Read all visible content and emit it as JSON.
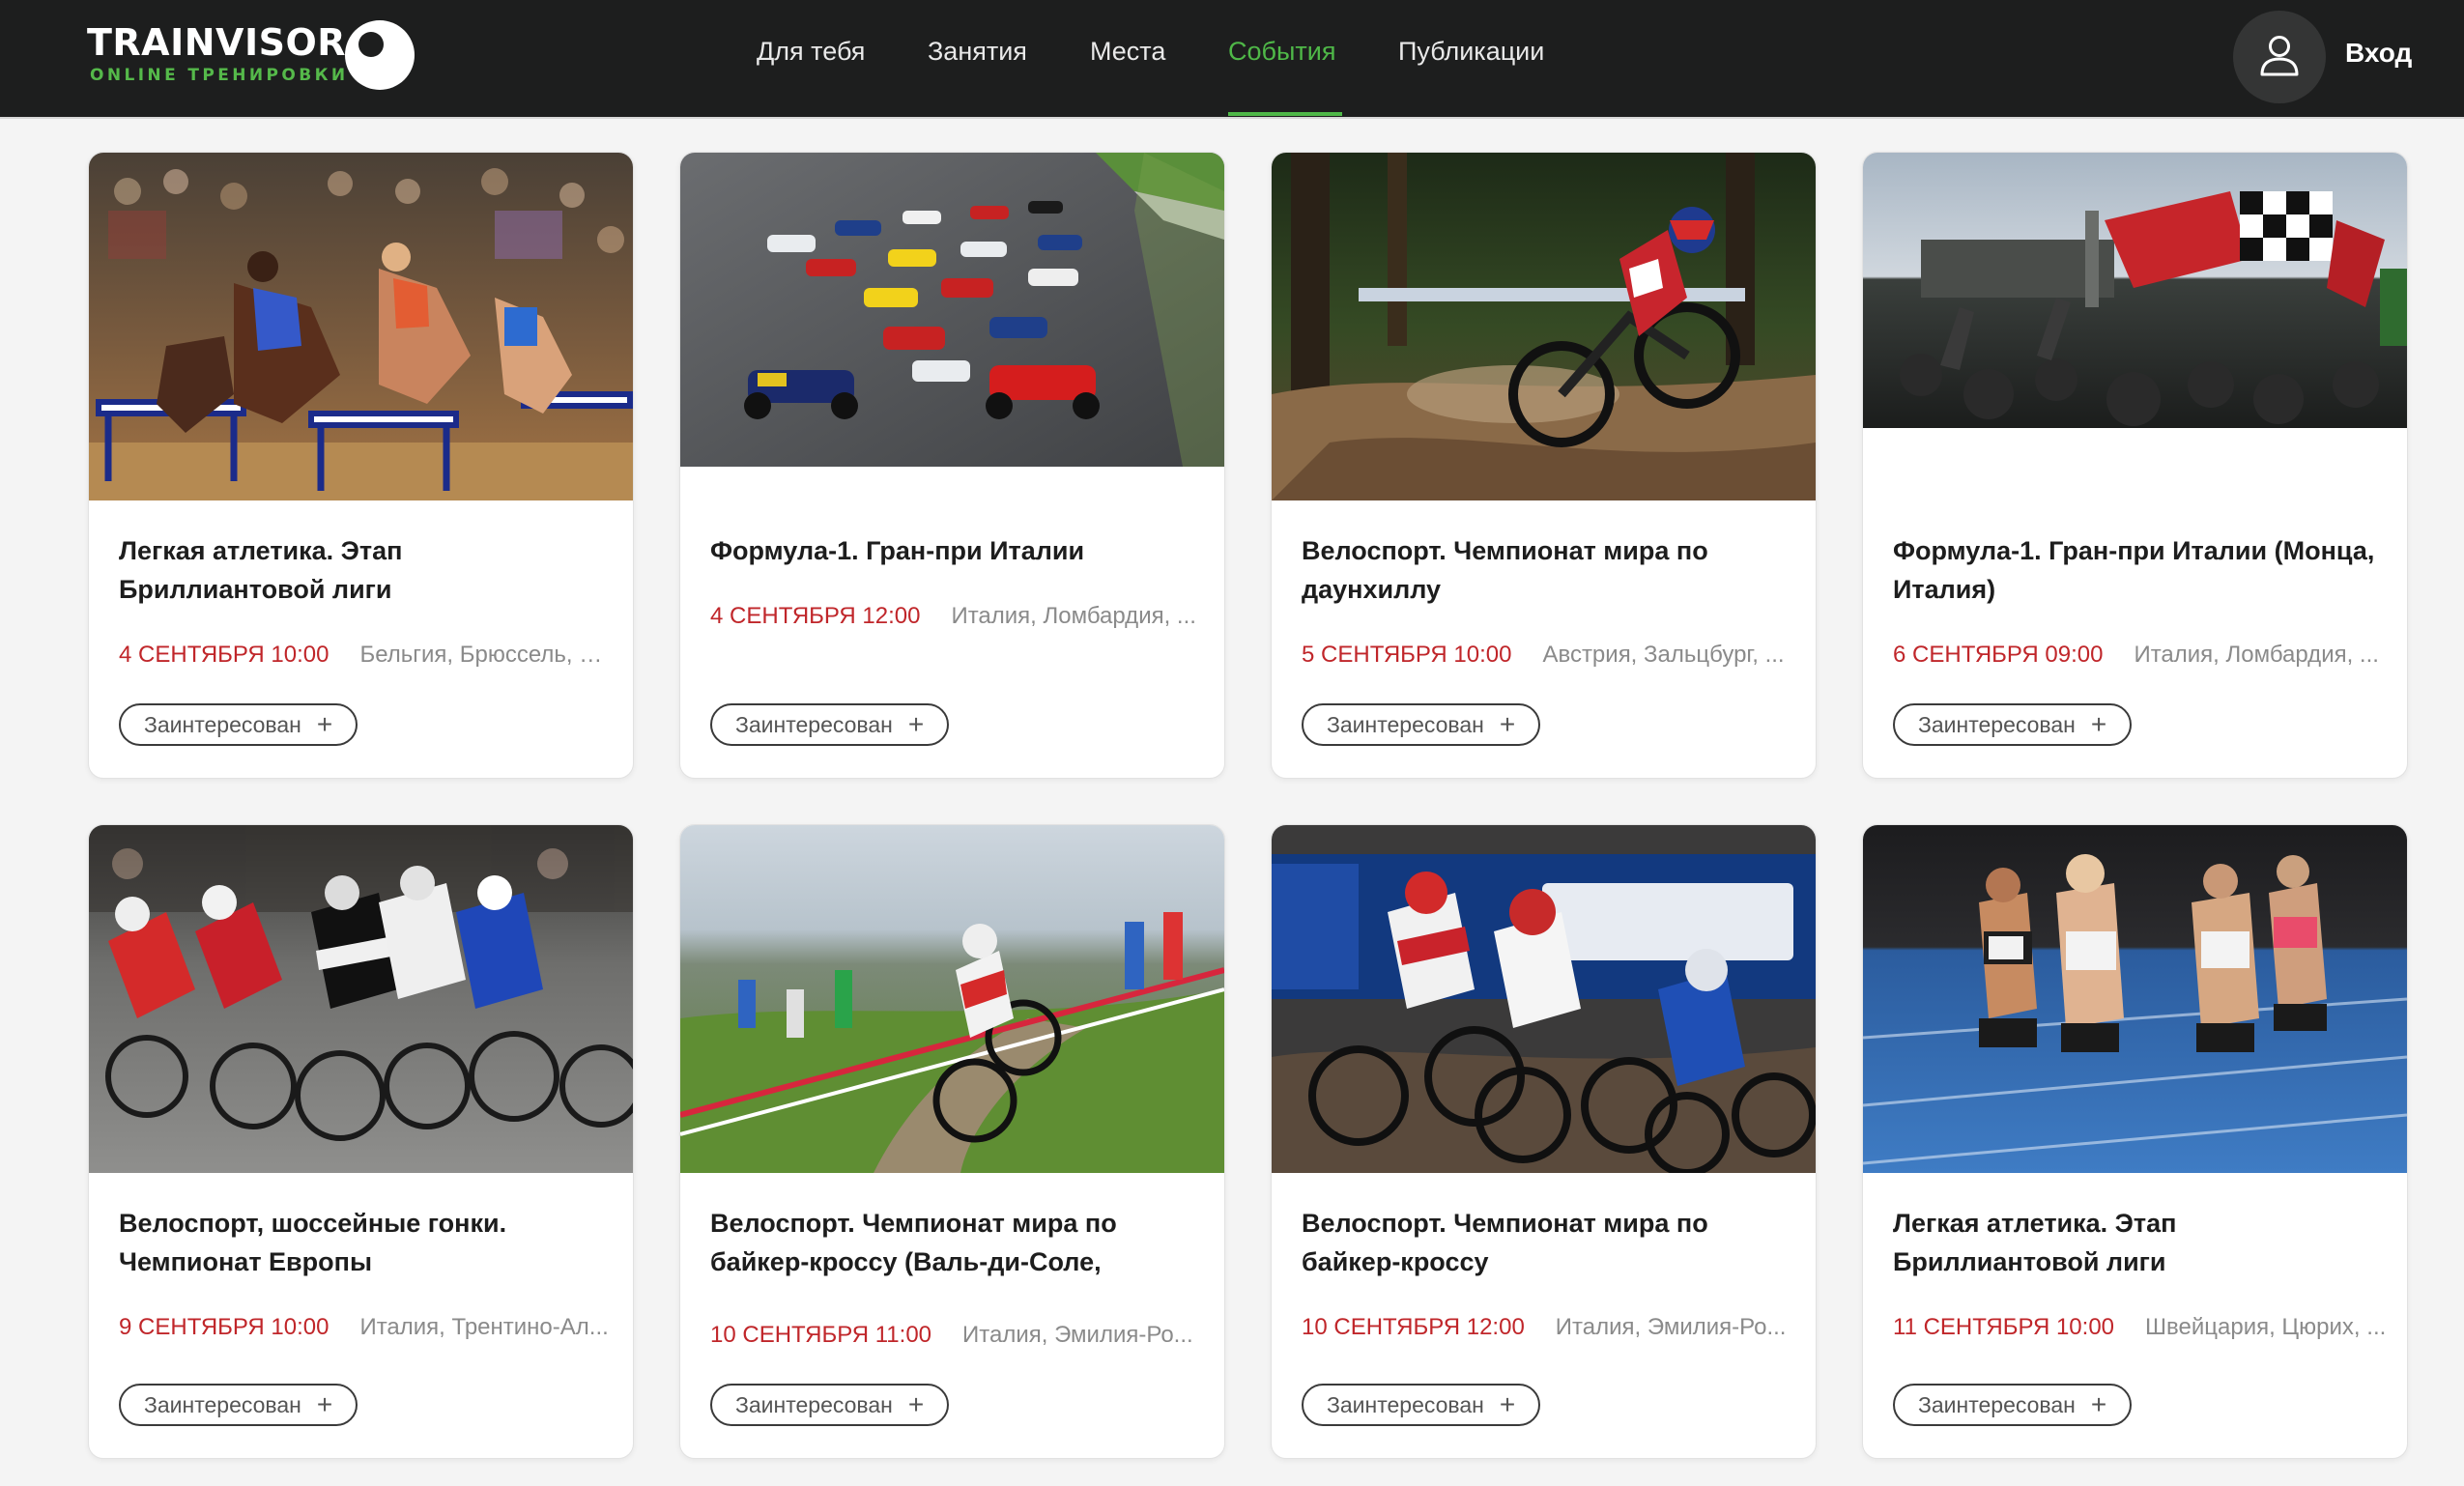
{
  "brand": {
    "name": "TRAINVISOR",
    "tagline": "ONLINE ТРЕНИРОВКИ",
    "logo_icon": "eye-logo-icon"
  },
  "nav": {
    "items": [
      {
        "label": "Для тебя"
      },
      {
        "label": "Занятия"
      },
      {
        "label": "Места"
      },
      {
        "label": "События",
        "active": true
      },
      {
        "label": "Публикации"
      }
    ]
  },
  "auth": {
    "login_label": "Вход",
    "avatar_icon": "user-icon"
  },
  "colors": {
    "header_bg": "#1d1e1e",
    "accent_green": "#4fb848",
    "date_red": "#c0262a",
    "page_bg": "#f4f4f4"
  },
  "events": [
    {
      "title": "Легкая атлетика. Этап Бриллиантовой лиги",
      "date": "4 сентября 10:00",
      "place": "Бельгия, Брюссель, R...",
      "button_label": "Заинтересован",
      "image": "hurdles-race-photo"
    },
    {
      "title": "Формула-1. Гран-при Италии",
      "date": "4 сентября 12:00",
      "place": "Италия, Ломбардия, ...",
      "button_label": "Заинтересован",
      "image": "formula1-race-start-photo"
    },
    {
      "title": "Велоспорт. Чемпионат мира по даунхиллу",
      "date": "5 сентября 10:00",
      "place": "Австрия, Зальцбург, ...",
      "button_label": "Заинтересован",
      "image": "downhill-rider-photo"
    },
    {
      "title": "Формула-1. Гран-при Италии (Монца, Италия)",
      "date": "6 сентября 09:00",
      "place": "Италия, Ломбардия, ...",
      "button_label": "Заинтересован",
      "image": "monza-fans-flags-photo"
    },
    {
      "title": "Велоспорт, шоссейные гонки. Чемпионат Европы",
      "date": "9 сентября 10:00",
      "place": "Италия, Трентино-Ал...",
      "button_label": "Заинтересован",
      "image": "road-cycling-peloton-photo"
    },
    {
      "title": "Велоспорт. Чемпионат мира по байкер-кроссу (Валь-ди-Соле,",
      "date": "10 сентября 11:00",
      "place": "Италия, Эмилия-Ро...",
      "button_label": "Заинтересован",
      "image": "xc-mountain-bike-photo"
    },
    {
      "title": "Велоспорт. Чемпионат мира по байкер-кроссу",
      "date": "10 сентября 12:00",
      "place": "Италия, Эмилия-Ро...",
      "button_label": "Заинтересован",
      "image": "four-cross-riders-photo"
    },
    {
      "title": "Легкая атлетика. Этап Бриллиантовой лиги",
      "date": "11 сентября 10:00",
      "place": "Швейцария, Цюрих, ...",
      "button_label": "Заинтересован",
      "image": "women-runners-track-photo"
    }
  ]
}
